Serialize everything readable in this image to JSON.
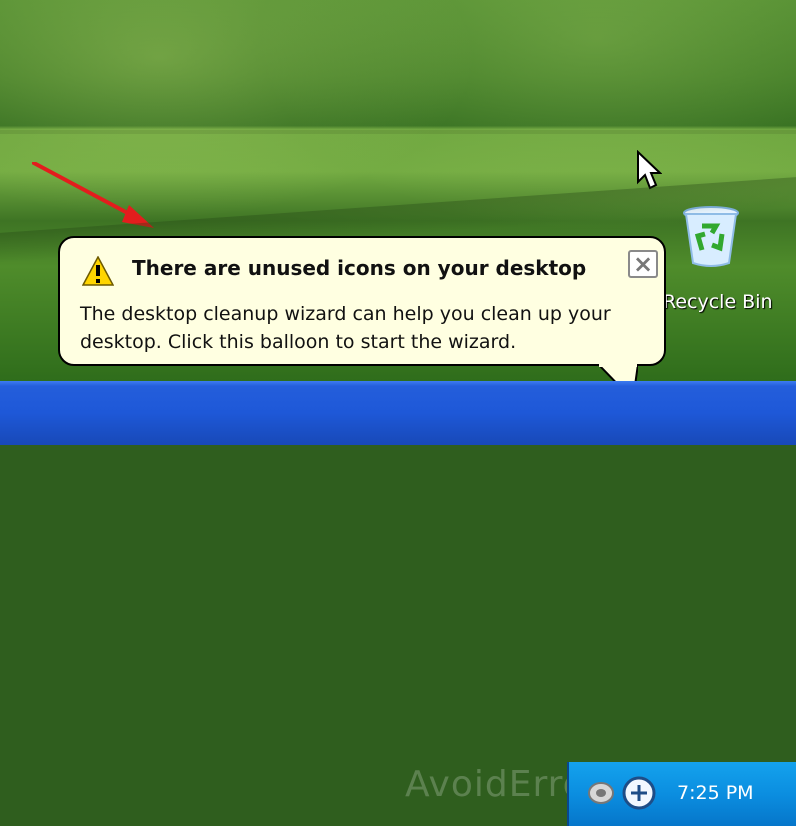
{
  "desktop": {
    "recycle_bin_label": "Recycle Bin"
  },
  "balloon": {
    "title": "There are unused icons on your desktop",
    "body": "The desktop cleanup wizard can help you clean up your desktop. Click this balloon to start the wizard.",
    "close_symbol": "×"
  },
  "taskbar": {
    "watermark": "AvoidErrors.com",
    "clock": "7:25 PM"
  },
  "icons": {
    "warning": "warning-triangle-icon",
    "close": "close-icon",
    "recycle_bin": "recycle-bin-icon",
    "speaker": "speaker-icon",
    "network": "network-icon",
    "cursor": "mouse-cursor-icon",
    "arrow": "red-pointer-arrow"
  },
  "colors": {
    "balloon_bg": "#ffffe1",
    "taskbar_blue": "#245edb",
    "tray_blue": "#0b8ee0",
    "warning_yellow": "#ffd500",
    "annotation_red": "#e31d1d"
  }
}
